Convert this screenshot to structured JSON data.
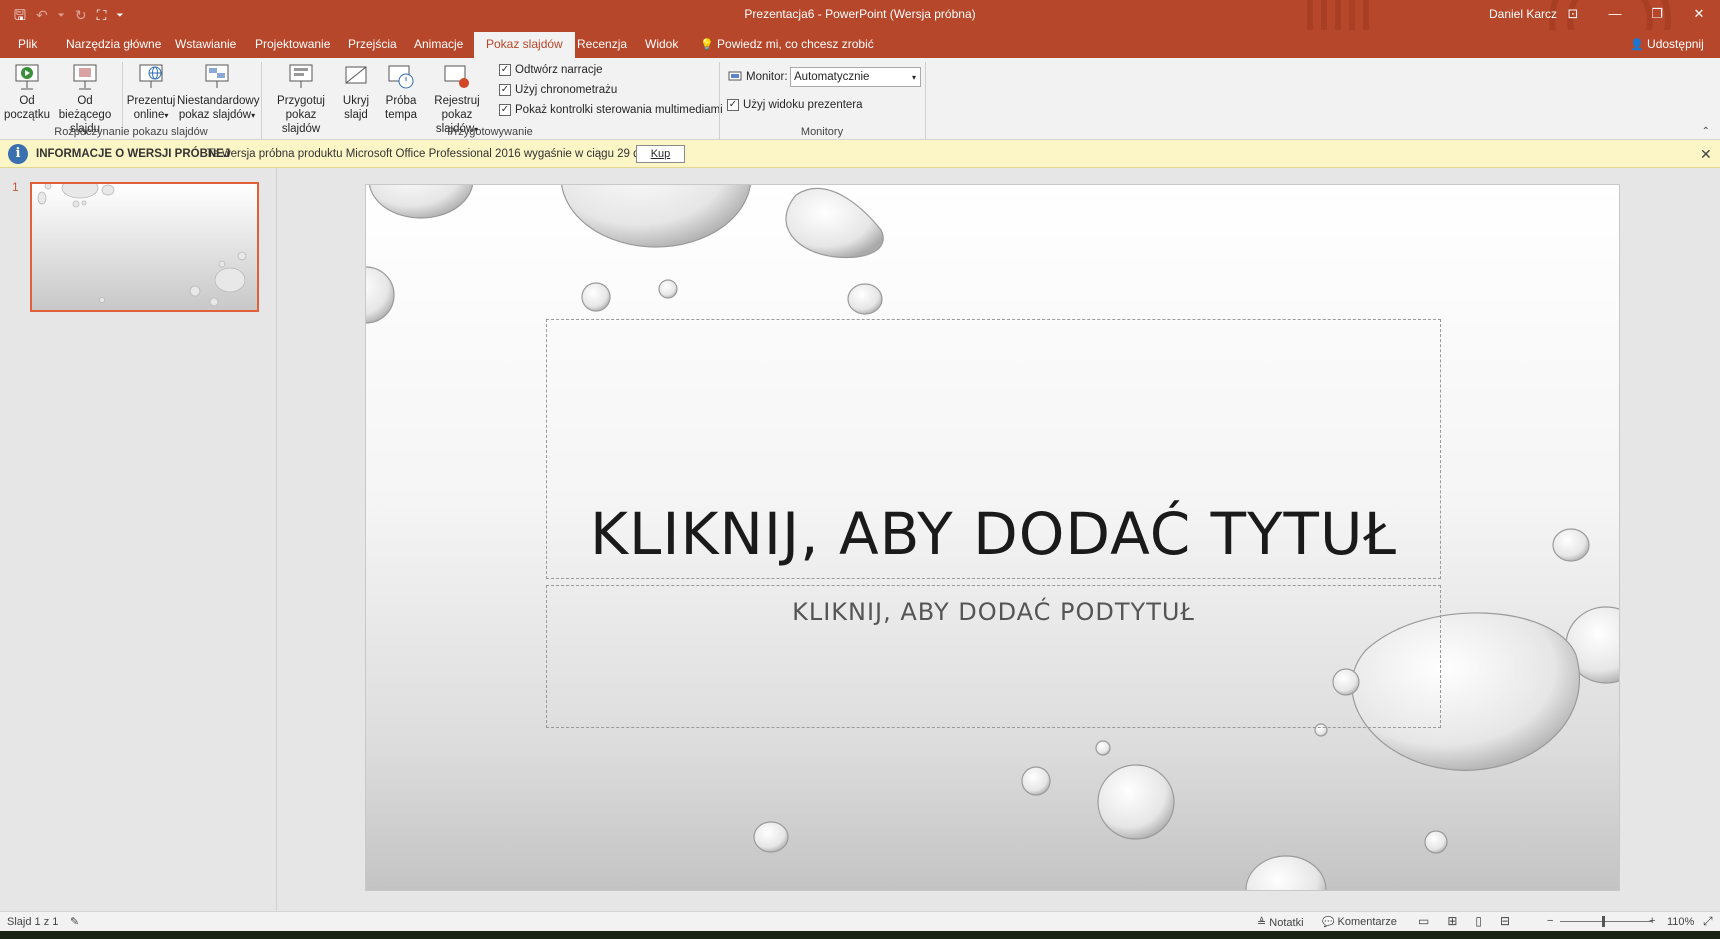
{
  "title_bar": {
    "title": "Prezentacja6  -  PowerPoint (Wersja próbna)",
    "user": "Daniel Karcz",
    "qat": {
      "save": "🖫",
      "undo": "↶",
      "undo_more": "⏷",
      "redo": "↻",
      "present": "⛶",
      "customize": "⏷"
    },
    "window_buttons": {
      "ribbon_options": "⊡",
      "minimize": "—",
      "restore": "❐",
      "close": "✕"
    }
  },
  "tabs": [
    {
      "label": "Plik",
      "active": false
    },
    {
      "label": "Narzędzia główne",
      "active": false
    },
    {
      "label": "Wstawianie",
      "active": false
    },
    {
      "label": "Projektowanie",
      "active": false
    },
    {
      "label": "Przejścia",
      "active": false
    },
    {
      "label": "Animacje",
      "active": false
    },
    {
      "label": "Pokaz slajdów",
      "active": true
    },
    {
      "label": "Recenzja",
      "active": false
    },
    {
      "label": "Widok",
      "active": false
    }
  ],
  "tell_me": "Powiedz mi, co chcesz zrobić",
  "tell_me_icon": "💡",
  "share": "Udostępnij",
  "share_icon": "👤",
  "ribbon": {
    "start_group": {
      "label": "Rozpoczynanie pokazu slajdów",
      "from_beginning_1": "Od",
      "from_beginning_2": "początku",
      "from_current_1": "Od bieżącego",
      "from_current_2": "slajdu",
      "present_online_1": "Prezentuj",
      "present_online_2": "online",
      "custom_show_1": "Niestandardowy",
      "custom_show_2": "pokaz slajdów"
    },
    "setup_group": {
      "label": "Przygotowywanie",
      "setup_show_1": "Przygotuj",
      "setup_show_2": "pokaz slajdów",
      "hide_slide_1": "Ukryj",
      "hide_slide_2": "slajd",
      "rehearse_1": "Próba",
      "rehearse_2": "tempa",
      "record_1": "Rejestruj pokaz",
      "record_2": "slajdów",
      "play_narrations": "Odtwórz narracje",
      "use_timings": "Użyj chronometrażu",
      "show_media_controls": "Pokaż kontrolki sterowania multimediami"
    },
    "monitors_group": {
      "label": "Monitory",
      "monitor_label": "Monitor:",
      "monitor_value": "Automatycznie",
      "presenter_view": "Użyj widoku prezentera"
    },
    "checked": "✓",
    "dropdown_arrow": "▾",
    "collapse_icon": "⌃"
  },
  "info_bar": {
    "title": "INFORMACJE O WERSJI PRÓBNEJ",
    "text": "Ta wersja próbna produktu Microsoft Office Professional 2016 wygaśnie w ciągu 29 dni.",
    "buy_button": "Kup",
    "icon": "i",
    "close": "✕"
  },
  "thumbnails": {
    "slide_number": "1"
  },
  "slide": {
    "title_placeholder": "KLIKNIJ, ABY DODAĆ TYTUŁ",
    "subtitle_placeholder": "KLIKNIJ, ABY DODAĆ PODTYTUŁ"
  },
  "status_bar": {
    "slide_count": "Slajd 1 z 1",
    "spell_icon": "✎",
    "notes": "Notatki",
    "notes_icon": "≜",
    "comments": "Komentarze",
    "comments_icon": "💬",
    "view_normal": "▭",
    "view_sorter": "⊞",
    "view_reading": "▯",
    "view_slideshow": "⊟",
    "zoom_minus": "−",
    "zoom_plus": "+",
    "zoom": "110%",
    "fit_icon": "⤢"
  },
  "colors": {
    "accent": "#b7472a",
    "info_bar": "#fcf5c6",
    "thumb_selected": "#e0603a"
  }
}
